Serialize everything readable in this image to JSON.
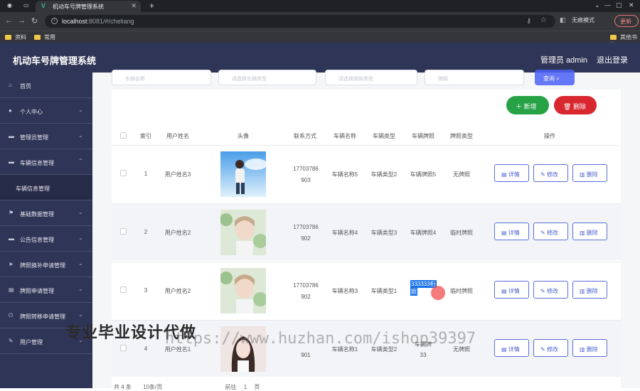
{
  "browser": {
    "tab_title": "机动车号牌管理系统",
    "url_host": "localhost",
    "url_rest": ":8081/#/cheliang",
    "incognito_label": "无痕模式",
    "update_label": "更新",
    "bookmarks": [
      "资料",
      "常用"
    ],
    "bookmark_right": "其他书签"
  },
  "header": {
    "title": "机动车号牌管理系统",
    "user": "管理员 admin",
    "logout": "退出登录"
  },
  "sidebar": {
    "items": [
      {
        "label": "首页",
        "icon": "home-icon"
      },
      {
        "label": "个人中心",
        "icon": "user-icon"
      },
      {
        "label": "管理员管理",
        "icon": "monitor-icon"
      },
      {
        "label": "车辆信息管理",
        "icon": "chat-icon"
      },
      {
        "label": "基础数据管理",
        "icon": "flag-icon"
      },
      {
        "label": "公告信息管理",
        "icon": "chat-icon"
      },
      {
        "label": "牌照换补申请管理",
        "icon": "send-icon"
      },
      {
        "label": "牌照申请管理",
        "icon": "doc-icon"
      },
      {
        "label": "牌照转移申请管理",
        "icon": "power-icon"
      },
      {
        "label": "用户管理",
        "icon": "pen-icon"
      }
    ],
    "sub_item": "车辆信息管理"
  },
  "search": {
    "field1": "车辆名称",
    "field2": "请选择车辆类型",
    "field3": "请选择牌照类型",
    "field4": "牌照",
    "query_label": "查询"
  },
  "actions": {
    "add": "新增",
    "delete": "删除"
  },
  "table": {
    "headers": [
      "索引",
      "用户姓名",
      "头像",
      "联系方式",
      "车辆名称",
      "车辆类型",
      "车辆牌照",
      "牌照类型",
      "操作"
    ],
    "rows": [
      {
        "idx": "1",
        "name": "用户姓名3",
        "phone1": "17703786",
        "phone2": "903",
        "car": "车辆名称5",
        "type": "车辆类型2",
        "plate": "车辆牌照5",
        "ptype": "无牌照"
      },
      {
        "idx": "2",
        "name": "用户姓名2",
        "phone1": "17703786",
        "phone2": "902",
        "car": "车辆名称4",
        "type": "车辆类型3",
        "plate": "车辆牌照4",
        "ptype": "临时牌照"
      },
      {
        "idx": "3",
        "name": "用户姓名2",
        "phone1": "17703786",
        "phone2": "902",
        "car": "车辆名称3",
        "type": "车辆类型1",
        "plate_sel1": "333333桁",
        "plate_sel2": "照",
        "ptype": "临时牌照"
      },
      {
        "idx": "4",
        "name": "用户姓名1",
        "phone1": "",
        "phone2": "901",
        "car": "车辆名称1",
        "type": "车辆类型2",
        "plate1": "车辆牌",
        "plate2": "33",
        "ptype": "无牌照"
      }
    ],
    "row_actions": {
      "detail": "详情",
      "edit": "修改",
      "delete": "删除"
    }
  },
  "pager": {
    "total": "共 4 条",
    "size": "10条/页",
    "goto": "前往",
    "page": "1",
    "unit": "页"
  },
  "watermark": {
    "cn": "专业毕业设计代做",
    "url": "https://www.huzhan.com/ishop39397"
  }
}
